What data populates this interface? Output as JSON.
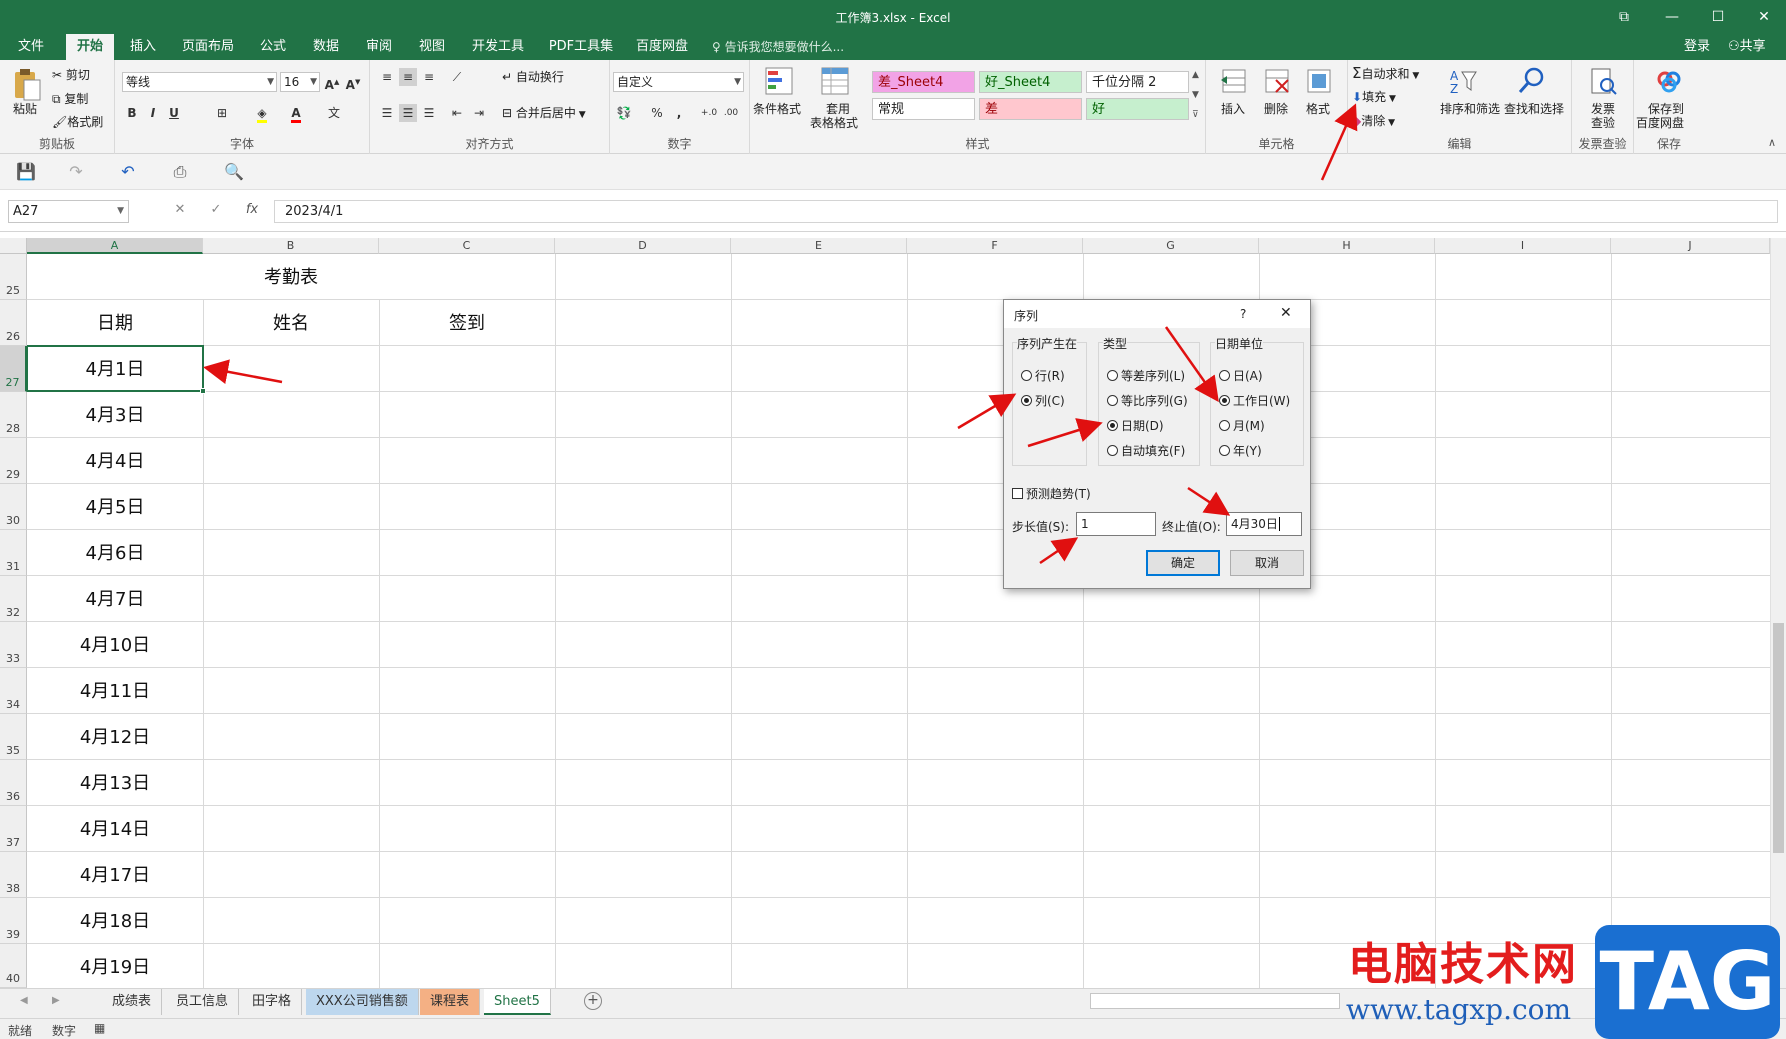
{
  "window": {
    "title": "工作簿3.xlsx - Excel"
  },
  "tabs": [
    "文件",
    "开始",
    "插入",
    "页面布局",
    "公式",
    "数据",
    "审阅",
    "视图",
    "开发工具",
    "PDF工具集",
    "百度网盘"
  ],
  "tell_me": "告诉我您想要做什么...",
  "account": {
    "login": "登录",
    "share": "共享"
  },
  "ribbon": {
    "clipboard": {
      "paste": "粘贴",
      "cut": "剪切",
      "copy": "复制",
      "format_painter": "格式刷",
      "label": "剪贴板"
    },
    "font": {
      "name": "等线",
      "size": "16",
      "bold": "B",
      "italic": "I",
      "underline": "U",
      "label": "字体"
    },
    "alignment": {
      "wrap": "自动换行",
      "merge": "合并后居中",
      "label": "对齐方式"
    },
    "number": {
      "format": "自定义",
      "percent": "%",
      "comma": ",",
      "label": "数字"
    },
    "styles": {
      "conditional": "条件格式",
      "table_format_1": "套用",
      "table_format_2": "表格格式",
      "cells": [
        "差_Sheet4",
        "好_Sheet4",
        "千位分隔 2",
        "常规",
        "差",
        "好"
      ],
      "cell_colors": [
        "#f2a3e6",
        "#c6efce",
        "#ffffff",
        "#ffffff",
        "#ffc7ce",
        "#c6efce"
      ],
      "label": "样式"
    },
    "cells": {
      "insert": "插入",
      "delete": "删除",
      "format": "格式",
      "label": "单元格"
    },
    "editing": {
      "autosum": "自动求和",
      "fill": "填充",
      "clear": "清除",
      "sort_filter": "排序和筛选",
      "find_select": "查找和选择",
      "label": "编辑"
    },
    "invoice": {
      "btn1": "发票",
      "btn2": "查验",
      "label": "发票查验"
    },
    "save": {
      "btn1": "保存到",
      "btn2": "百度网盘",
      "label": "保存"
    }
  },
  "formula_bar": {
    "name_box": "A27",
    "fx": "fx",
    "value": "2023/4/1"
  },
  "columns": [
    "A",
    "B",
    "C",
    "D",
    "E",
    "F",
    "G",
    "H",
    "I",
    "J"
  ],
  "rows": [
    "25",
    "26",
    "27",
    "28",
    "29",
    "30",
    "31",
    "32",
    "33",
    "34",
    "35",
    "36",
    "37",
    "38",
    "39",
    "40"
  ],
  "sheet": {
    "title": "考勤表",
    "headers": [
      "日期",
      "姓名",
      "签到"
    ],
    "dates": [
      "4月1日",
      "4月3日",
      "4月4日",
      "4月5日",
      "4月6日",
      "4月7日",
      "4月10日",
      "4月11日",
      "4月12日",
      "4月13日",
      "4月14日",
      "4月17日",
      "4月18日",
      "4月19日"
    ]
  },
  "sheet_tabs": [
    "成绩表",
    "员工信息",
    "田字格",
    "XXX公司销售额",
    "课程表",
    "Sheet5"
  ],
  "status": {
    "ready": "就绪",
    "mode": "数字"
  },
  "dialog": {
    "title": "序列",
    "help": "?",
    "close": "✕",
    "series_in": {
      "label": "序列产生在",
      "options": [
        "行(R)",
        "列(C)"
      ],
      "selected": "列(C)"
    },
    "type": {
      "label": "类型",
      "options": [
        "等差序列(L)",
        "等比序列(G)",
        "日期(D)",
        "自动填充(F)"
      ],
      "selected": "日期(D)"
    },
    "date_unit": {
      "label": "日期单位",
      "options": [
        "日(A)",
        "工作日(W)",
        "月(M)",
        "年(Y)"
      ],
      "selected": "工作日(W)"
    },
    "trend": "预测趋势(T)",
    "step_label": "步长值(S):",
    "step_value": "1",
    "stop_label": "终止值(O):",
    "stop_value": "4月30日",
    "ok": "确定",
    "cancel": "取消"
  },
  "watermark": {
    "text": "电脑技术网",
    "url": "www.tagxp.com",
    "logo": "TAG"
  },
  "accent_color": "#217346"
}
